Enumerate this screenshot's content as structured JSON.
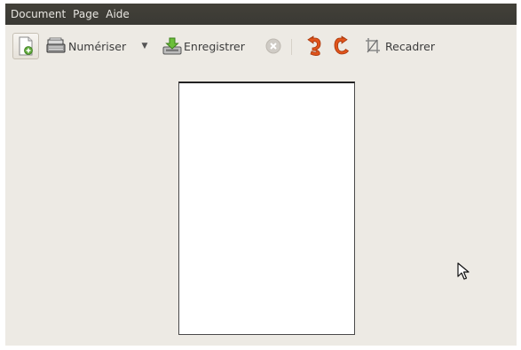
{
  "menubar": {
    "items": [
      "Document",
      "Page",
      "Aide"
    ]
  },
  "toolbar": {
    "new_icon": "new-document-icon",
    "scan_label": "Numériser",
    "scan_menu_arrow": "▼",
    "save_label": "Enregistrer",
    "stop_icon": "stop-icon",
    "rotate_left_icon": "rotate-left-icon",
    "rotate_right_icon": "rotate-right-icon",
    "crop_label": "Recadrer"
  },
  "colors": {
    "window_bg": "#edeae4",
    "menubar_bg": "#3c3b37",
    "rotate_orange": "#e0541b"
  }
}
